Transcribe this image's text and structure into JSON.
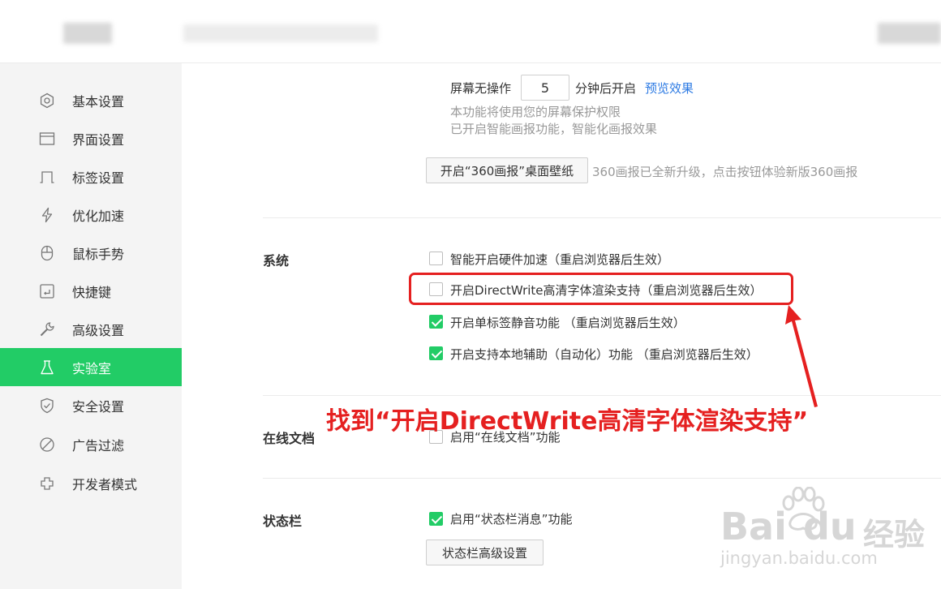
{
  "sidebar": {
    "items": [
      {
        "label": "基本设置",
        "icon": "settings-icon"
      },
      {
        "label": "界面设置",
        "icon": "window-icon"
      },
      {
        "label": "标签设置",
        "icon": "tab-icon"
      },
      {
        "label": "优化加速",
        "icon": "lightning-icon"
      },
      {
        "label": "鼠标手势",
        "icon": "mouse-icon"
      },
      {
        "label": "快捷键",
        "icon": "keyboard-icon"
      },
      {
        "label": "高级设置",
        "icon": "wrench-icon"
      },
      {
        "label": "实验室",
        "icon": "flask-icon",
        "active": true
      },
      {
        "label": "安全设置",
        "icon": "shield-icon"
      },
      {
        "label": "广告过滤",
        "icon": "block-icon"
      },
      {
        "label": "开发者模式",
        "icon": "puzzle-icon"
      }
    ]
  },
  "screensaver": {
    "prefix": "屏幕无操作",
    "minutes": "5",
    "suffix": "分钟后开启",
    "preview_link": "预览效果",
    "desc1": "本功能将使用您的屏幕保护权限",
    "desc2": "已开启智能画报功能，智能化画报效果",
    "wallpaper_button": "开启“360画报”桌面壁纸",
    "wallpaper_note": "360画报已全新升级，点击按钮体验新版360画报"
  },
  "system": {
    "title": "系统",
    "options": [
      {
        "label": "智能开启硬件加速（重启浏览器后生效）",
        "checked": false
      },
      {
        "label": "开启DirectWrite高清字体渲染支持（重启浏览器后生效）",
        "checked": false
      },
      {
        "label": "开启单标签静音功能 （重启浏览器后生效）",
        "checked": true
      },
      {
        "label": "开启支持本地辅助（自动化）功能 （重启浏览器后生效）",
        "checked": true
      }
    ]
  },
  "online_docs": {
    "title": "在线文档",
    "option": {
      "label": "启用“在线文档”功能",
      "checked": false
    }
  },
  "statusbar": {
    "title": "状态栏",
    "option": {
      "label": "启用“状态栏消息”功能",
      "checked": true
    },
    "advanced_button": "状态栏高级设置"
  },
  "annotation": {
    "text": "找到“开启DirectWrite高清字体渲染支持”",
    "color": "#e52020"
  },
  "watermark": {
    "brand": "Bai",
    "brand2": "du",
    "cn": "经验",
    "url": "jingyan.baidu.com"
  },
  "colors": {
    "accent": "#22cc66",
    "link": "#2c7ae3",
    "highlight": "#e52020"
  }
}
